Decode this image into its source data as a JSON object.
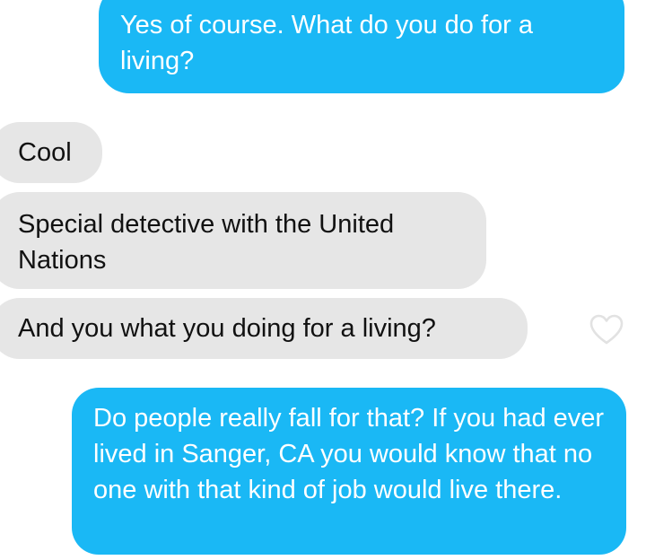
{
  "conversation": {
    "messages": [
      {
        "sender": "me",
        "text": "Yes of course. What do you do for a living?"
      },
      {
        "sender": "them",
        "text": "Cool"
      },
      {
        "sender": "them",
        "text": "Special detective with the United Nations"
      },
      {
        "sender": "them",
        "text": "And you what you doing for a living?"
      },
      {
        "sender": "me",
        "text": "Do people really fall for that? If you had ever lived in Sanger, CA you would know that no one with that kind of job would live there."
      }
    ]
  },
  "icons": {
    "like": "heart-outline-icon"
  },
  "colors": {
    "sent_bubble": "#1ab8f5",
    "received_bubble": "#e6e6e6",
    "sent_text": "#ffffff",
    "received_text": "#111111",
    "heart_outline": "#e2e2e2"
  }
}
